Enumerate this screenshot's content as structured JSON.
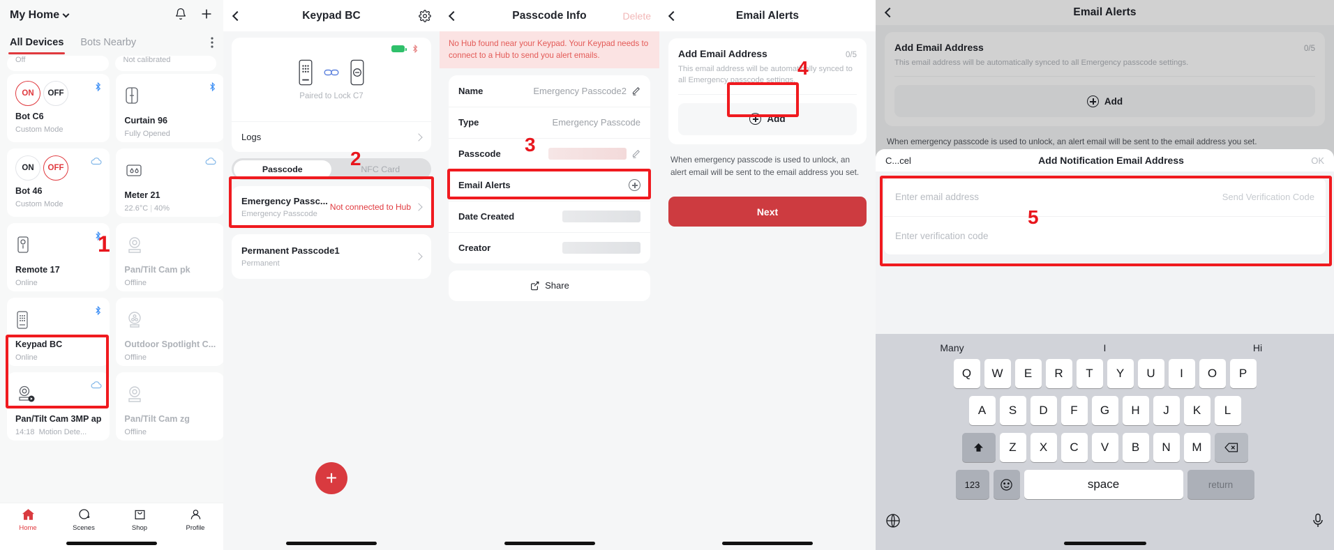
{
  "panel1": {
    "home_name": "My Home",
    "tabs": [
      {
        "label": "All Devices",
        "active": true
      },
      {
        "label": "Bots Nearby",
        "active": false
      }
    ],
    "partial_cards": [
      {
        "sub": "Off"
      },
      {
        "sub": "Not calibrated"
      }
    ],
    "cards": [
      {
        "title": "Bot C6",
        "sub": "Custom Mode",
        "kind": "onoff",
        "on_selected": true,
        "conn": "bluetooth-icon",
        "dim": false
      },
      {
        "title": "Curtain 96",
        "sub": "Fully Opened",
        "kind": "curtain-icon",
        "conn": "bluetooth-icon",
        "dim": false
      },
      {
        "title": "Bot 46",
        "sub": "Custom Mode",
        "kind": "onoff",
        "on_selected": false,
        "conn": "cloud-icon",
        "dim": false
      },
      {
        "title": "Meter 21",
        "sub": "22.6°C",
        "sub2": "40%",
        "kind": "meter-icon",
        "conn": "cloud-icon",
        "dim": false
      },
      {
        "title": "Remote 17",
        "sub": "Online",
        "kind": "remote-icon",
        "conn": "bluetooth-icon",
        "dim": false
      },
      {
        "title": "Pan/Tilt Cam pk",
        "sub": "Offline",
        "kind": "camera-icon",
        "conn": "none",
        "dim": true
      },
      {
        "title": "Keypad BC",
        "sub": "Online",
        "kind": "keypad-icon",
        "conn": "bluetooth-icon",
        "dim": false
      },
      {
        "title": "Outdoor Spotlight C...",
        "sub": "Offline",
        "kind": "spotlight-icon",
        "conn": "none",
        "dim": true
      },
      {
        "title": "Pan/Tilt Cam 3MP ap",
        "sub": "14:18",
        "sub2": "Motion Dete...",
        "kind": "camera-play-icon",
        "conn": "cloud-icon",
        "dim": false
      },
      {
        "title": "Pan/Tilt Cam zg",
        "sub": "Offline",
        "kind": "camera-icon",
        "conn": "none",
        "dim": true
      }
    ],
    "tabbar": [
      {
        "label": "Home",
        "icon": "home-icon",
        "active": true
      },
      {
        "label": "Scenes",
        "icon": "scenes-icon",
        "active": false
      },
      {
        "label": "Shop",
        "icon": "shop-icon",
        "active": false
      },
      {
        "label": "Profile",
        "icon": "profile-icon",
        "active": false
      }
    ],
    "annotation": "1"
  },
  "panel2": {
    "title": "Keypad BC",
    "paired_text": "Paired to Lock C7",
    "logs_label": "Logs",
    "segments": [
      {
        "label": "Passcode",
        "active": true
      },
      {
        "label": "NFC Card",
        "active": false
      }
    ],
    "passcodes": [
      {
        "name": "Emergency Passc...",
        "type": "Emergency Passcode",
        "status": "Not connected to Hub"
      },
      {
        "name": "Permanent Passcode1",
        "type": "Permanent",
        "status": ""
      }
    ],
    "fab_label": "+",
    "annotation": "2"
  },
  "panel3": {
    "title": "Passcode Info",
    "delete_label": "Delete",
    "warning": "No Hub found near your Keypad. Your Keypad needs to connect to a Hub to send you alert emails.",
    "rows": [
      {
        "label": "Name",
        "value": "Emergency Passcode2",
        "edit": true,
        "redacted": false
      },
      {
        "label": "Type",
        "value": "Emergency Passcode",
        "edit": false,
        "redacted": false
      },
      {
        "label": "Passcode",
        "value": "",
        "edit": true,
        "redacted": true
      },
      {
        "label": "Email Alerts",
        "value": "",
        "edit": false,
        "redacted": false,
        "plus": true
      },
      {
        "label": "Date Created",
        "value": "",
        "edit": false,
        "redacted": true
      },
      {
        "label": "Creator",
        "value": "",
        "edit": false,
        "redacted": true
      }
    ],
    "share_label": "Share",
    "annotation": "3"
  },
  "panel4": {
    "title": "Email Alerts",
    "card_title": "Add Email Address",
    "counter": "0/5",
    "description": "This email address will be automatically synced to all Emergency passcode settings.",
    "add_label": "Add",
    "note": "When emergency passcode is used to unlock, an alert email will be sent to the email address you set.",
    "next_label": "Next",
    "annotation": "4"
  },
  "panel5": {
    "title": "Email Alerts",
    "bg_card_title": "Add Email Address",
    "bg_counter": "0/5",
    "bg_description": "This email address will be automatically synced to all Emergency passcode settings.",
    "bg_add_label": "Add",
    "bg_note": "When emergency passcode is used to unlock, an alert email will be sent to the email address you set.",
    "sheet": {
      "cancel_label": "C...cel",
      "title": "Add Notification Email Address",
      "ok_label": "OK",
      "email_placeholder": "Enter email address",
      "send_code_label": "Send Verification Code",
      "code_placeholder": "Enter verification code"
    },
    "keyboard": {
      "suggestions": [
        "Many",
        "I",
        "Hi"
      ],
      "row1": [
        "Q",
        "W",
        "E",
        "R",
        "T",
        "Y",
        "U",
        "I",
        "O",
        "P"
      ],
      "row2": [
        "A",
        "S",
        "D",
        "F",
        "G",
        "H",
        "J",
        "K",
        "L"
      ],
      "row3": [
        "Z",
        "X",
        "C",
        "V",
        "B",
        "N",
        "M"
      ],
      "shift_icon": "shift-icon",
      "backspace_icon": "backspace-icon",
      "num_label": "123",
      "emoji_icon": "emoji-icon",
      "space_label": "space",
      "return_label": "return",
      "globe_icon": "globe-icon",
      "mic_icon": "microphone-icon"
    },
    "annotation": "5"
  },
  "colors": {
    "accent_red": "#e0393e",
    "highlight_red": "#f01a1f",
    "bluetooth_blue": "#3d8ff5",
    "cloud_blue": "#7fb5e8"
  }
}
